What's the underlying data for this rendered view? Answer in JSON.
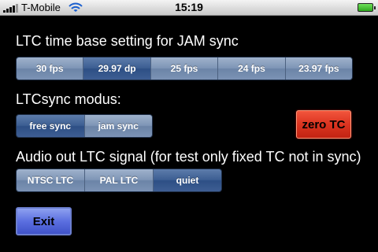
{
  "status_bar": {
    "carrier": "T-Mobile",
    "time": "15:19",
    "signal_bars": 4,
    "icons": [
      "signal-bars-icon",
      "wifi-icon",
      "battery-charging-icon"
    ]
  },
  "ltc_time_base": {
    "label": "LTC time base setting for JAM sync",
    "options": [
      "30 fps",
      "29.97 dp",
      "25 fps",
      "24 fps",
      "23.97 fps"
    ],
    "selected": "29.97 dp"
  },
  "ltcsync_modus": {
    "label": "LTCsync modus:",
    "options": [
      "free sync",
      "jam sync"
    ],
    "selected": "free sync"
  },
  "zero_tc": {
    "label": "zero TC",
    "color": "#db3420"
  },
  "audio_out": {
    "label": "Audio out LTC signal (for test only fixed TC not in sync)",
    "options": [
      "NTSC LTC",
      "PAL LTC",
      "quiet"
    ],
    "selected": "quiet"
  },
  "exit": {
    "label": "Exit",
    "color": "#5b6fe0"
  },
  "colors": {
    "segment_normal": "#7e95b6",
    "segment_selected": "#3c5e92",
    "background": "#000000"
  }
}
